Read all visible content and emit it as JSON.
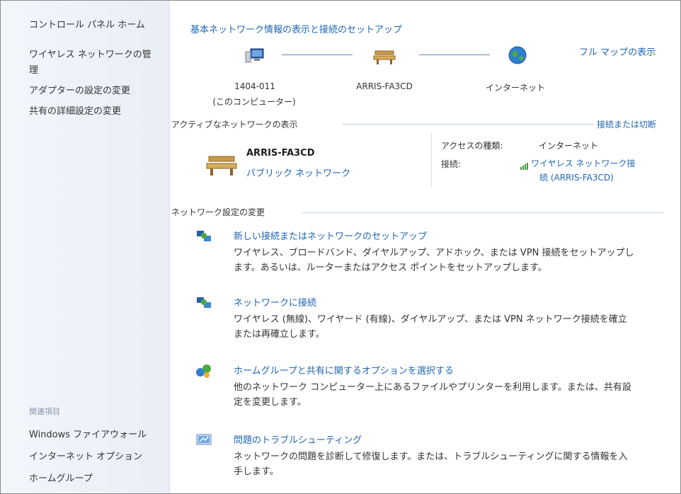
{
  "sidebar": {
    "home": "コントロール パネル ホーム",
    "wireless_1": "ワイヤレス ネットワークの管",
    "wireless_2": "理",
    "adapter": "アダプターの設定の変更",
    "sharing": "共有の詳細設定の変更",
    "related": "関連項目",
    "firewall": "Windows ファイアウォール",
    "internet_options": "インターネット オプション",
    "homegroup": "ホームグループ"
  },
  "header": {
    "title": "基本ネットワーク情報の表示と接続のセットアップ",
    "full_map": "フル マップの表示"
  },
  "map": {
    "computer_name": "1404-011",
    "computer_sub": "(このコンピューター)",
    "network_name": "ARRIS-FA3CD",
    "internet": "インターネット"
  },
  "active": {
    "section_title": "アクティブなネットワークの表示",
    "connect_link": "接続または切断",
    "name": "ARRIS-FA3CD",
    "type": "パブリック ネットワーク",
    "access_label": "アクセスの種類:",
    "access_value": "インターネット",
    "conn_label": "接続:",
    "conn_link_1": "ワイヤレス ネットワーク接",
    "conn_link_2": "続 (ARRIS-FA3CD)"
  },
  "settings": {
    "section_title": "ネットワーク設定の変更",
    "tasks": [
      {
        "title": "新しい接続またはネットワークのセットアップ",
        "desc_1": "ワイヤレス、ブロードバンド、ダイヤルアップ、アドホック、または VPN 接続をセットアップし",
        "desc_2": "ます。あるいは、ルーターまたはアクセス ポイントをセットアップします。"
      },
      {
        "title": "ネットワークに接続",
        "desc_1": "ワイヤレス (無線)、ワイヤード (有線)、ダイヤルアップ、または VPN ネットワーク接続を確立",
        "desc_2": "または再確立します。"
      },
      {
        "title": "ホームグループと共有に関するオプションを選択する",
        "desc_1": "他のネットワーク コンピューター上にあるファイルやプリンターを利用します。または、共有設",
        "desc_2": "定を変更します。"
      },
      {
        "title": "問題のトラブルシューティング",
        "desc_1": "ネットワークの問題を診断して修復します。または、トラブルシューティングに関する情報を入",
        "desc_2": "手します。"
      }
    ]
  }
}
